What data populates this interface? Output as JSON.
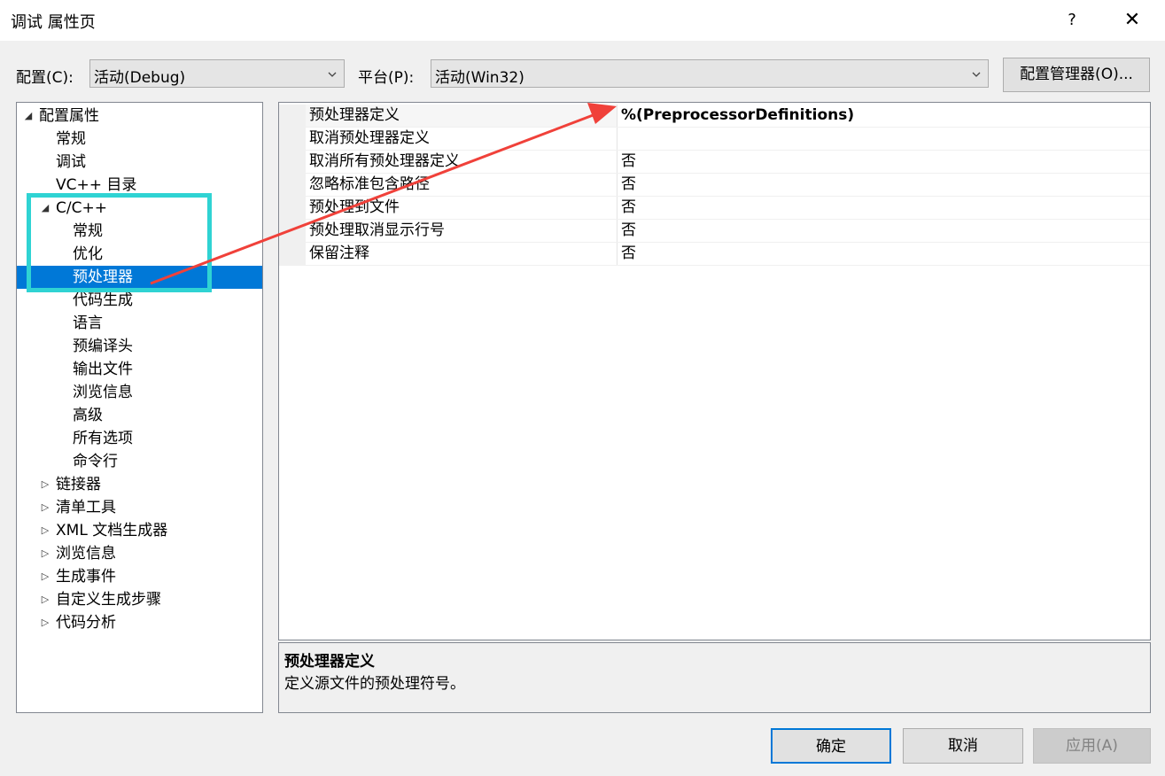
{
  "window": {
    "title": "调试 属性页",
    "help": "?",
    "close": "✕"
  },
  "toolbar": {
    "config_label": "配置(C):",
    "config_value": "活动(Debug)",
    "platform_label": "平台(P):",
    "platform_value": "活动(Win32)",
    "config_manager": "配置管理器(O)..."
  },
  "tree": [
    {
      "label": "配置属性",
      "expander": "expanded",
      "level": 0
    },
    {
      "label": "常规",
      "expander": "none",
      "level": 1
    },
    {
      "label": "调试",
      "expander": "none",
      "level": 1
    },
    {
      "label": "VC++ 目录",
      "expander": "none",
      "level": 1
    },
    {
      "label": "C/C++",
      "expander": "expanded",
      "level": 1
    },
    {
      "label": "常规",
      "expander": "none",
      "level": 2
    },
    {
      "label": "优化",
      "expander": "none",
      "level": 2
    },
    {
      "label": "预处理器",
      "expander": "none",
      "level": 2,
      "selected": true
    },
    {
      "label": "代码生成",
      "expander": "none",
      "level": 2
    },
    {
      "label": "语言",
      "expander": "none",
      "level": 2
    },
    {
      "label": "预编译头",
      "expander": "none",
      "level": 2
    },
    {
      "label": "输出文件",
      "expander": "none",
      "level": 2
    },
    {
      "label": "浏览信息",
      "expander": "none",
      "level": 2
    },
    {
      "label": "高级",
      "expander": "none",
      "level": 2
    },
    {
      "label": "所有选项",
      "expander": "none",
      "level": 2
    },
    {
      "label": "命令行",
      "expander": "none",
      "level": 2
    },
    {
      "label": "链接器",
      "expander": "collapsed",
      "level": 1
    },
    {
      "label": "清单工具",
      "expander": "collapsed",
      "level": 1
    },
    {
      "label": "XML 文档生成器",
      "expander": "collapsed",
      "level": 1
    },
    {
      "label": "浏览信息",
      "expander": "collapsed",
      "level": 1
    },
    {
      "label": "生成事件",
      "expander": "collapsed",
      "level": 1
    },
    {
      "label": "自定义生成步骤",
      "expander": "collapsed",
      "level": 1
    },
    {
      "label": "代码分析",
      "expander": "collapsed",
      "level": 1
    }
  ],
  "properties": [
    {
      "name": "预处理器定义",
      "value": "%(PreprocessorDefinitions)",
      "bold": true
    },
    {
      "name": "取消预处理器定义",
      "value": ""
    },
    {
      "name": "取消所有预处理器定义",
      "value": "否"
    },
    {
      "name": "忽略标准包含路径",
      "value": "否"
    },
    {
      "name": "预处理到文件",
      "value": "否"
    },
    {
      "name": "预处理取消显示行号",
      "value": "否"
    },
    {
      "name": "保留注释",
      "value": "否"
    }
  ],
  "description": {
    "title": "预处理器定义",
    "text": "定义源文件的预处理符号。"
  },
  "buttons": {
    "ok": "确定",
    "cancel": "取消",
    "apply": "应用(A)"
  },
  "annotation": {
    "box_color": "#2fd3d3",
    "arrow_color": "#f0413a"
  },
  "colors": {
    "selection": "#0078d7",
    "default_button_border": "#0078d7"
  }
}
